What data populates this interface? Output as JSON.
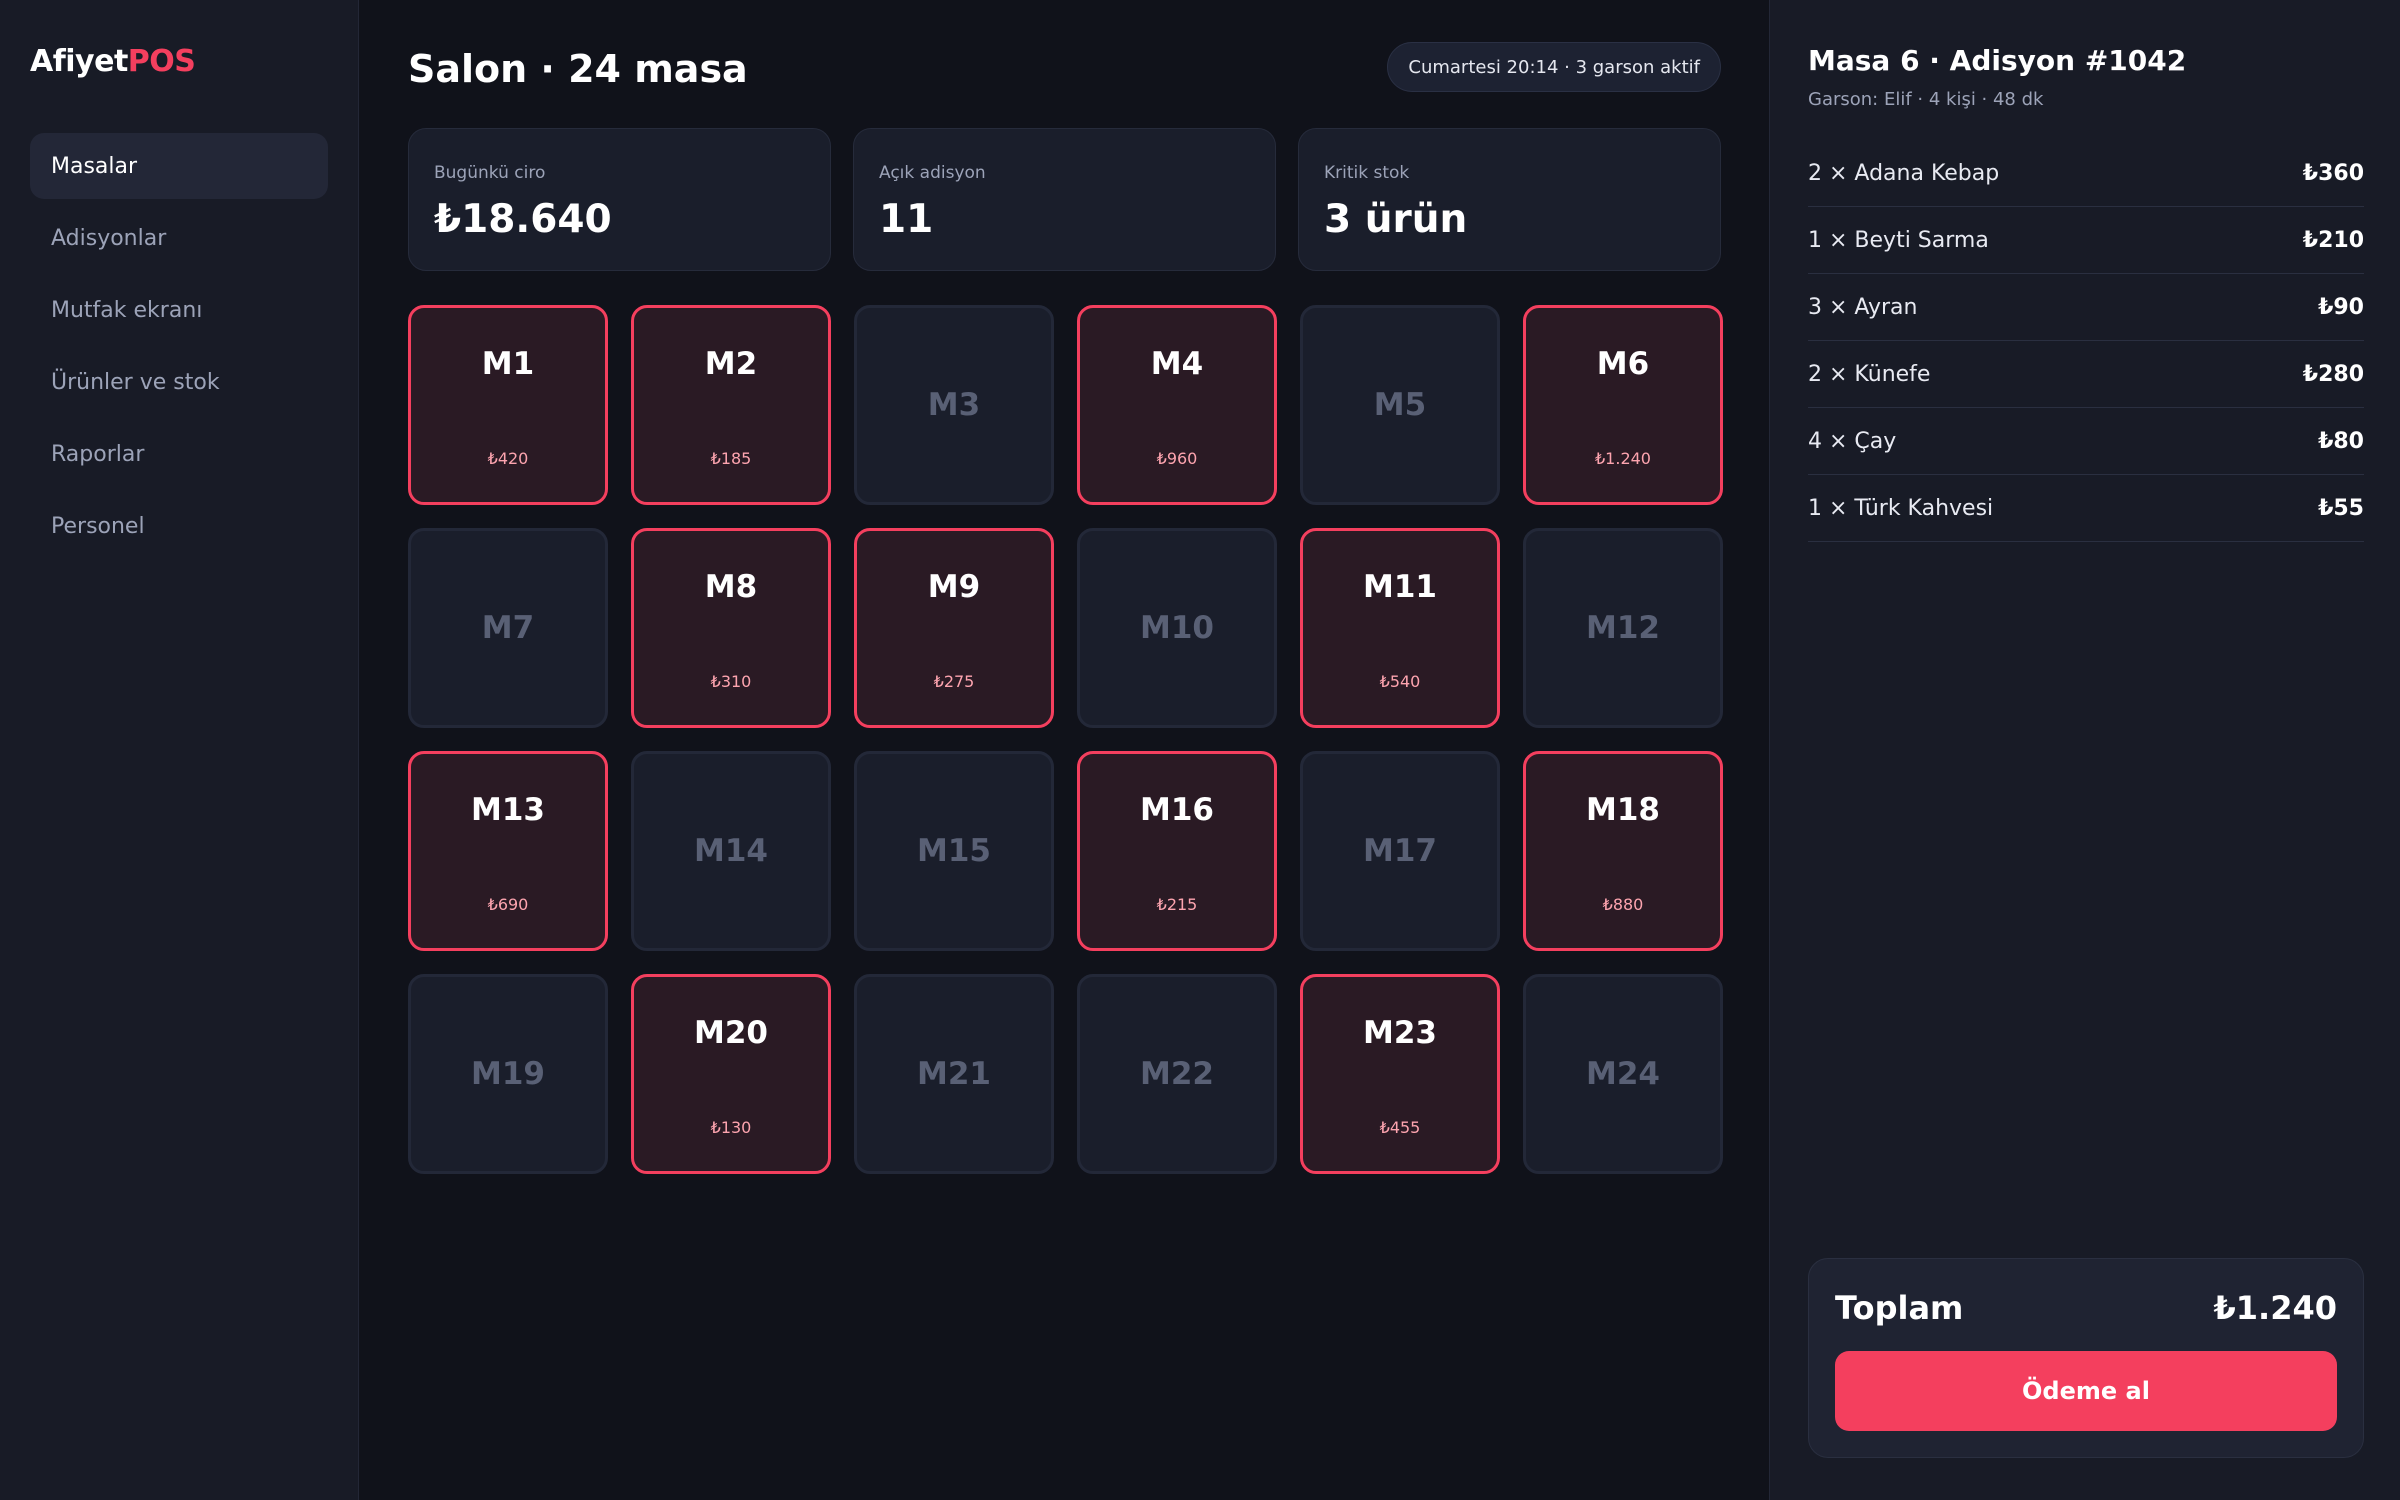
{
  "brand": {
    "name": "Afiyet",
    "accent": "POS",
    "accent_color": "#f43f5e"
  },
  "sidebar": {
    "items": [
      {
        "label": "Masalar",
        "active": true
      },
      {
        "label": "Adisyonlar",
        "active": false
      },
      {
        "label": "Mutfak ekranı",
        "active": false
      },
      {
        "label": "Ürünler ve stok",
        "active": false
      },
      {
        "label": "Raporlar",
        "active": false
      },
      {
        "label": "Personel",
        "active": false
      }
    ]
  },
  "header": {
    "title": "Salon · 24 masa",
    "status": "Cumartesi 20:14 · 3 garson aktif"
  },
  "stats": [
    {
      "label": "Bugünkü ciro",
      "value": "₺18.640"
    },
    {
      "label": "Açık adisyon",
      "value": "11"
    },
    {
      "label": "Kritik stok",
      "value": "3 ürün"
    }
  ],
  "tables": [
    {
      "name": "M1",
      "occupied": true,
      "amount": "₺420"
    },
    {
      "name": "M2",
      "occupied": true,
      "amount": "₺185"
    },
    {
      "name": "M3",
      "occupied": false,
      "amount": ""
    },
    {
      "name": "M4",
      "occupied": true,
      "amount": "₺960"
    },
    {
      "name": "M5",
      "occupied": false,
      "amount": ""
    },
    {
      "name": "M6",
      "occupied": true,
      "amount": "₺1.240"
    },
    {
      "name": "M7",
      "occupied": false,
      "amount": ""
    },
    {
      "name": "M8",
      "occupied": true,
      "amount": "₺310"
    },
    {
      "name": "M9",
      "occupied": true,
      "amount": "₺275"
    },
    {
      "name": "M10",
      "occupied": false,
      "amount": ""
    },
    {
      "name": "M11",
      "occupied": true,
      "amount": "₺540"
    },
    {
      "name": "M12",
      "occupied": false,
      "amount": ""
    },
    {
      "name": "M13",
      "occupied": true,
      "amount": "₺690"
    },
    {
      "name": "M14",
      "occupied": false,
      "amount": ""
    },
    {
      "name": "M15",
      "occupied": false,
      "amount": ""
    },
    {
      "name": "M16",
      "occupied": true,
      "amount": "₺215"
    },
    {
      "name": "M17",
      "occupied": false,
      "amount": ""
    },
    {
      "name": "M18",
      "occupied": true,
      "amount": "₺880"
    },
    {
      "name": "M19",
      "occupied": false,
      "amount": ""
    },
    {
      "name": "M20",
      "occupied": true,
      "amount": "₺130"
    },
    {
      "name": "M21",
      "occupied": false,
      "amount": ""
    },
    {
      "name": "M22",
      "occupied": false,
      "amount": ""
    },
    {
      "name": "M23",
      "occupied": true,
      "amount": "₺455"
    },
    {
      "name": "M24",
      "occupied": false,
      "amount": ""
    }
  ],
  "order": {
    "title": "Masa 6 · Adisyon #1042",
    "subtitle": "Garson: Elif · 4 kişi · 48 dk",
    "lines": [
      {
        "item": "2 × Adana Kebap",
        "price": "₺360"
      },
      {
        "item": "1 × Beyti Sarma",
        "price": "₺210"
      },
      {
        "item": "3 × Ayran",
        "price": "₺90"
      },
      {
        "item": "2 × Künefe",
        "price": "₺280"
      },
      {
        "item": "4 × Çay",
        "price": "₺80"
      },
      {
        "item": "1 × Türk Kahvesi",
        "price": "₺55"
      }
    ],
    "total_label": "Toplam",
    "total_value": "₺1.240",
    "pay_label": "Ödeme al"
  }
}
